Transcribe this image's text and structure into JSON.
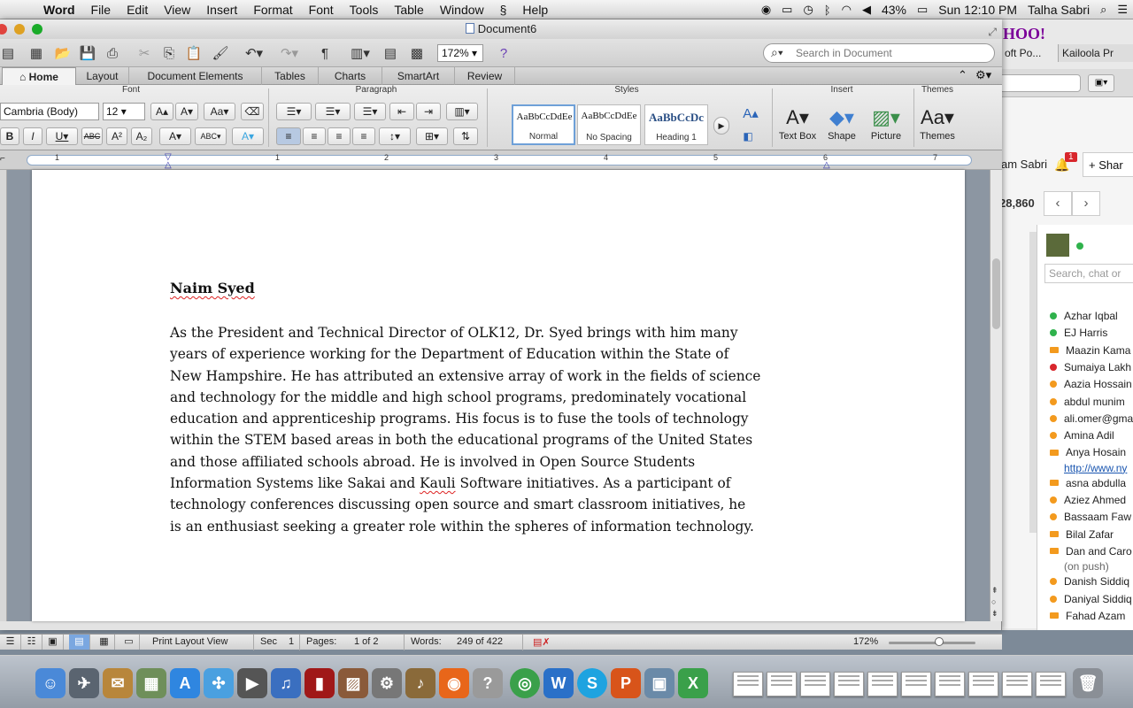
{
  "menubar": {
    "app": "Word",
    "items": [
      "File",
      "Edit",
      "View",
      "Insert",
      "Format",
      "Font",
      "Tools",
      "Table",
      "Window",
      "Help"
    ],
    "battery": "43%",
    "clock": "Sun 12:10 PM",
    "user": "Talha Sabri"
  },
  "window": {
    "title": "Document6"
  },
  "toolbar": {
    "zoom": "172%",
    "search_placeholder": "Search in Document"
  },
  "tabs": [
    "Home",
    "Layout",
    "Document Elements",
    "Tables",
    "Charts",
    "SmartArt",
    "Review"
  ],
  "ribbon": {
    "groups": {
      "font": "Font",
      "paragraph": "Paragraph",
      "styles": "Styles",
      "insert": "Insert",
      "themes": "Themes"
    },
    "font_name": "Cambria (Body)",
    "font_size": "12",
    "styles": [
      {
        "preview": "AaBbCcDdEe",
        "name": "Normal"
      },
      {
        "preview": "AaBbCcDdEe",
        "name": "No Spacing"
      },
      {
        "preview": "AaBbCcDc",
        "name": "Heading 1"
      }
    ],
    "insert_buttons": [
      "Text Box",
      "Shape",
      "Picture"
    ],
    "themes_button": "Themes"
  },
  "ruler": {
    "marks": [
      "1",
      "1",
      "2",
      "3",
      "4",
      "5",
      "6",
      "7"
    ]
  },
  "document": {
    "title": "Naim Syed",
    "body_lines": [
      "As the President and Technical Director of OLK12, Dr. Syed brings with him many",
      "years of experience working for the Department of Education within the State of",
      "New Hampshire. He has attributed an extensive array of work in the fields of science",
      "and technology for the middle and high school programs, predominately vocational",
      "education and apprenticeship programs. His focus is to fuse the tools of technology",
      "within the STEM based areas in both the educational programs of the United States",
      "and those affiliated schools abroad. He is involved in Open Source Students"
    ],
    "line8_before": "Information Systems like Sakai and ",
    "line8_misspelled": "Kauli",
    "line8_after": " Software initiatives. As a participant of",
    "line9": "technology conferences discussing open source and smart classroom initiatives, he",
    "line10": "is an enthusiast seeking a greater role within the spheres of information technology."
  },
  "statusbar": {
    "view": "Print Layout View",
    "sec_label": "Sec",
    "sec_value": "1",
    "pages_label": "Pages:",
    "pages_value": "1 of 2",
    "words_label": "Words:",
    "words_value": "249 of 422",
    "zoom": "172%"
  },
  "background_app": {
    "logo": "HOO!",
    "tab1": "oft Po...",
    "tab2": "Kailoola Pr",
    "user": "am Sabri",
    "notif_count": "1",
    "share": "Shar",
    "count": "28,860",
    "chat_search": "Search, chat or",
    "contacts": [
      {
        "name": "Azhar Iqbal",
        "status": "green"
      },
      {
        "name": "EJ Harris",
        "status": "green"
      },
      {
        "name": "Maazin Kama",
        "status": "video"
      },
      {
        "name": "Sumaiya Lakh",
        "status": "red"
      },
      {
        "name": "Aazia Hossain",
        "status": "orange"
      },
      {
        "name": "abdul munim",
        "status": "orange"
      },
      {
        "name": "ali.omer@gma",
        "status": "orange"
      },
      {
        "name": "Amina Adil",
        "status": "orange"
      },
      {
        "name": "Anya Hosain",
        "status": "video",
        "sub": "http://www.ny"
      },
      {
        "name": "asna abdulla",
        "status": "video"
      },
      {
        "name": "Aziez Ahmed",
        "status": "orange"
      },
      {
        "name": "Bassaam Faw",
        "status": "orange"
      },
      {
        "name": "Bilal Zafar",
        "status": "video"
      },
      {
        "name": "Dan and Caro",
        "status": "video",
        "sub": "(on push)"
      },
      {
        "name": "Danish Siddiq",
        "status": "orange"
      },
      {
        "name": "Daniyal Siddiq",
        "status": "orange"
      },
      {
        "name": "Fahad Azam",
        "status": "video"
      }
    ]
  },
  "colors": {
    "accent": "#6ea0d8",
    "spell_error": "#d22222",
    "status_green": "#2fb24c",
    "status_orange": "#f39a1e",
    "status_red": "#d8262c"
  }
}
